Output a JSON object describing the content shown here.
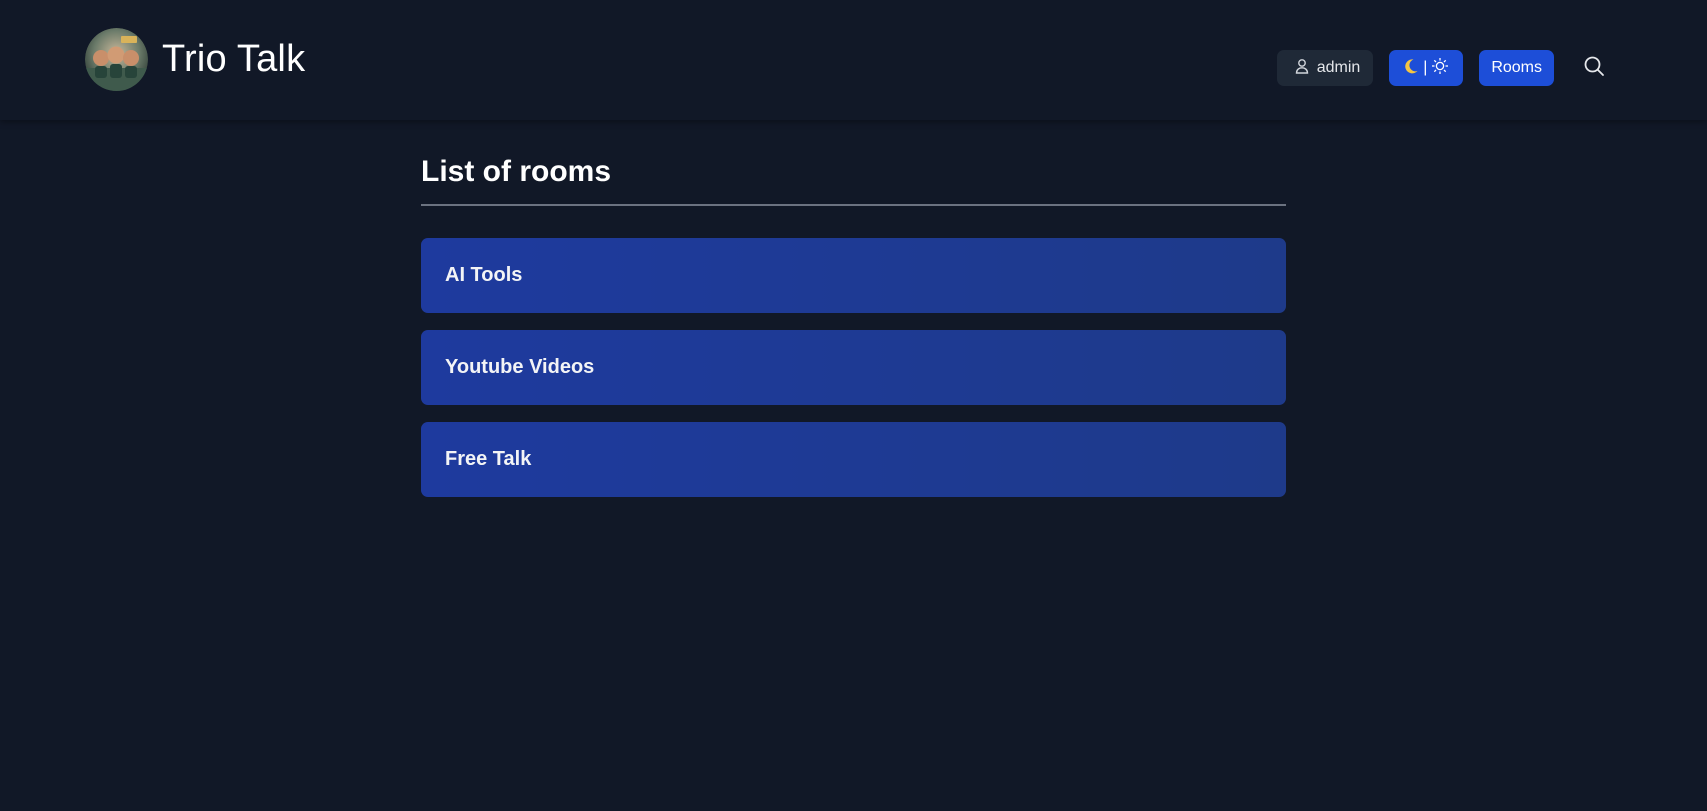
{
  "header": {
    "brand_title": "Trio Talk",
    "logo_icon": "avatar-logo-icon",
    "user": {
      "icon": "user-icon",
      "label": "admin"
    },
    "theme_toggle": {
      "moon_icon": "moon-icon",
      "separator": "|",
      "sun_icon": "sun-icon"
    },
    "rooms_label": "Rooms",
    "search_icon": "search-icon"
  },
  "main": {
    "title": "List of rooms",
    "rooms": [
      {
        "label": "AI Tools"
      },
      {
        "label": "Youtube Videos"
      },
      {
        "label": "Free Talk"
      }
    ]
  },
  "colors": {
    "background": "#111827",
    "accent": "#1d4ed8",
    "room_card": "#1e3a8a",
    "user_button": "#1f2937"
  }
}
